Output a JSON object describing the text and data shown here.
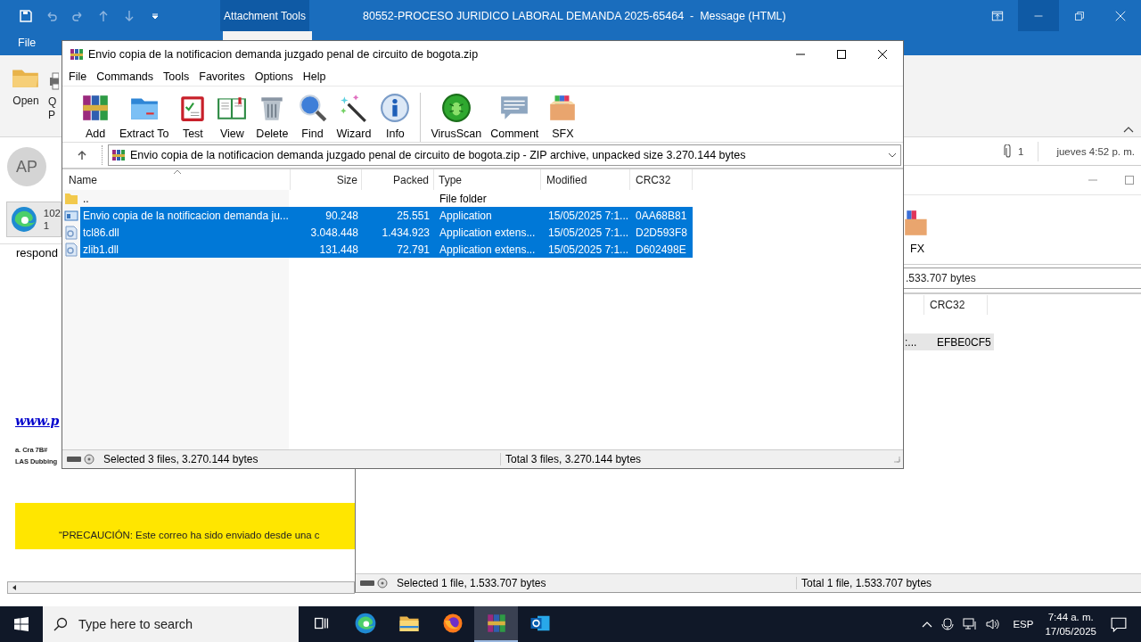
{
  "outlook": {
    "context_tab": "Attachment Tools",
    "title": "80552-PROCESO JURIDICO LABORAL DEMANDA 2025-65464  -  Message (HTML)",
    "ribbon_tab": "File",
    "ribbon_buttons": [
      {
        "kind": "open",
        "label": "Open"
      },
      {
        "kind": "print",
        "label": "Q",
        "label_2": "P"
      }
    ]
  },
  "message": {
    "avatar": "AP",
    "attachment_name": "102",
    "attachment_size": "1",
    "attachment_count": "1",
    "date": "jueves 4:52 p. m.",
    "body": "respond",
    "link": "www.p",
    "address_1": "a. Cra 7B#",
    "address_2": "LAS Dubbing",
    "caution": "“PRECAUCIÓN: Este correo ha sido enviado desde una c"
  },
  "archive_back": {
    "tool": "FX",
    "path": ".533.707 bytes",
    "column": "CRC32",
    "row": {
      "modified_tail": ":...",
      "crc": "EFBE0CF5",
      "selected": true
    },
    "status_selected": "Selected 1 file, 1.533.707 bytes",
    "status_total": "Total 1 file, 1.533.707 bytes"
  },
  "archive": {
    "title": "Envio copia de la notificacion demanda juzgado penal de circuito de bogota.zip",
    "menu": [
      "File",
      "Commands",
      "Tools",
      "Favorites",
      "Options",
      "Help"
    ],
    "tools": [
      {
        "kind": "add",
        "label": "Add"
      },
      {
        "kind": "extract",
        "label": "Extract To"
      },
      {
        "kind": "test",
        "label": "Test"
      },
      {
        "kind": "view",
        "label": "View"
      },
      {
        "kind": "delete",
        "label": "Delete"
      },
      {
        "kind": "find",
        "label": "Find"
      },
      {
        "kind": "wizard",
        "label": "Wizard"
      },
      {
        "kind": "info",
        "label": "Info"
      },
      {
        "kind": "virus",
        "label": "VirusScan"
      },
      {
        "kind": "comment",
        "label": "Comment"
      },
      {
        "kind": "sfx",
        "label": "SFX"
      }
    ],
    "path": "Envio copia de la notificacion demanda juzgado penal de circuito de bogota.zip - ZIP archive, unpacked size 3.270.144 bytes",
    "columns": [
      "Name",
      "Size",
      "Packed",
      "Type",
      "Modified",
      "CRC32"
    ],
    "rows": [
      {
        "kind": "folder",
        "name": "..",
        "type": "File folder",
        "selected": false
      },
      {
        "kind": "app",
        "name": "Envio copia de la notificacion demanda ju...",
        "size": "90.248",
        "packed": "25.551",
        "type": "Application",
        "modified": "15/05/2025 7:1...",
        "crc": "0AA68B81",
        "selected": true
      },
      {
        "kind": "dll",
        "name": "tcl86.dll",
        "size": "3.048.448",
        "packed": "1.434.923",
        "type": "Application extens...",
        "modified": "15/05/2025 7:1...",
        "crc": "D2D593F8",
        "selected": true
      },
      {
        "kind": "dll",
        "name": "zlib1.dll",
        "size": "131.448",
        "packed": "72.791",
        "type": "Application extens...",
        "modified": "15/05/2025 7:1...",
        "crc": "D602498E",
        "selected": true
      }
    ],
    "status_selected": "Selected 3 files, 3.270.144 bytes",
    "status_total": "Total 3 files, 3.270.144 bytes"
  },
  "taskbar": {
    "search_placeholder": "Type here to search",
    "apps": [
      {
        "kind": "taskview",
        "selected": false
      },
      {
        "kind": "edge",
        "selected": false
      },
      {
        "kind": "explorer",
        "selected": false
      },
      {
        "kind": "firefox",
        "selected": false
      },
      {
        "kind": "winrar",
        "selected": true
      },
      {
        "kind": "outlook",
        "selected": false
      }
    ],
    "language": "ESP",
    "time": "7:44 a. m.",
    "date": "17/05/2025"
  }
}
